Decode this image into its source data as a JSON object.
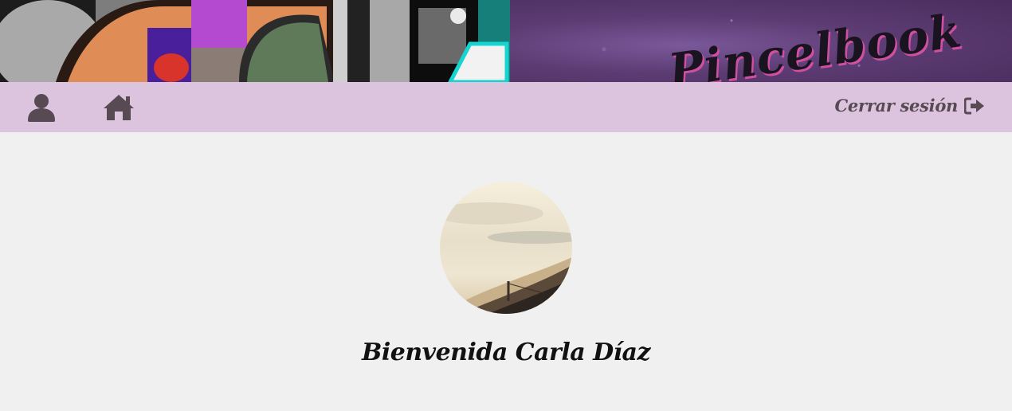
{
  "header": {
    "brand": "Pincelbook"
  },
  "nav": {
    "profile_icon": "user-icon",
    "home_icon": "home-icon",
    "logout_label": "Cerrar sesión",
    "logout_icon": "sign-out-icon"
  },
  "main": {
    "welcome_text": "Bienvenida Carla Díaz"
  },
  "colors": {
    "nav_background": "#dcc4df",
    "page_background": "#f0f0f0",
    "icon_color": "#574a52",
    "brand_shadow": "#d04fa0"
  }
}
